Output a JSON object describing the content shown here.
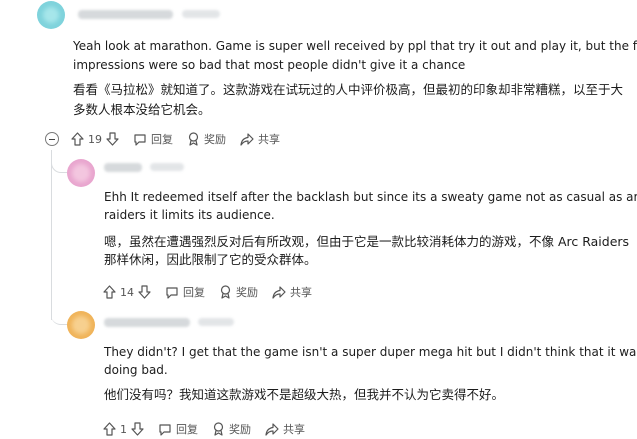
{
  "comments": [
    {
      "en_lines": [
        "Yeah look at marathon. Game is super well received by ppl that try it out and play it, but the first",
        "impressions were so bad that most people didn't give it a chance"
      ],
      "zh_lines": [
        "看看《马拉松》就知道了。这款游戏在试玩过的人中评价极高，但最初的印象却非常糟糕，以至于大",
        "多数人根本没给它机会。"
      ],
      "votes": "19",
      "reply_label": "回复",
      "award_label": "奖励",
      "share_label": "共享"
    },
    {
      "en_lines": [
        "Ehh It redeemed itself after the backlash but since its a sweaty game not as casual as arc",
        "raiders it limits its audience."
      ],
      "zh_lines": [
        "嗯，虽然在遭遇强烈反对后有所改观，但由于它是一款比较消耗体力的游戏，不像 Arc Raiders",
        "那样休闲，因此限制了它的受众群体。"
      ],
      "votes": "14",
      "reply_label": "回复",
      "award_label": "奖励",
      "share_label": "共享"
    },
    {
      "en_lines": [
        "They didn't? I get that the game isn't a super duper mega hit but I didn't think that it was",
        "doing bad."
      ],
      "zh_lines": [
        "他们没有吗？我知道这款游戏不是超级大热，但我并不认为它卖得不好。"
      ],
      "votes": "1",
      "reply_label": "回复",
      "award_label": "奖励",
      "share_label": "共享"
    }
  ],
  "colors": {
    "avatar1": "#7fd3dc",
    "avatar2": "#e9a6cf",
    "avatar3": "#f0b45a",
    "thread_line": "#d9dcdf"
  },
  "icons": [
    "upvote-icon",
    "downvote-icon",
    "reply-icon",
    "award-icon",
    "share-icon",
    "collapse-icon"
  ]
}
